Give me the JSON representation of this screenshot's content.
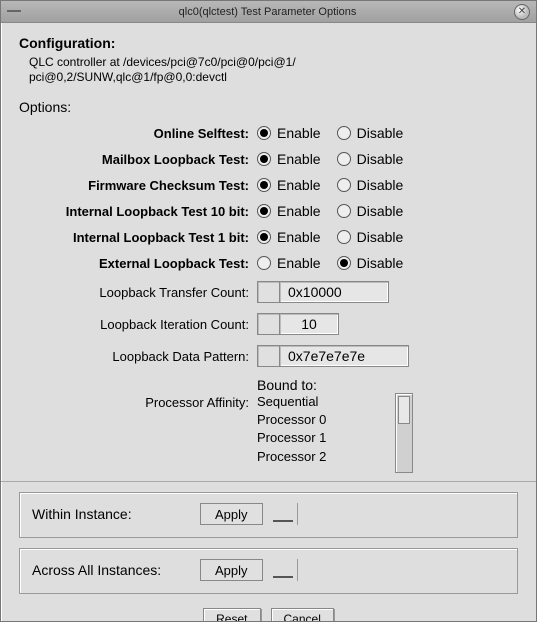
{
  "window": {
    "title": "qlc0(qlctest) Test Parameter Options"
  },
  "configuration": {
    "heading": "Configuration:",
    "body": "QLC controller at /devices/pci@7c0/pci@0/pci@1/\npci@0,2/SUNW,qlc@1/fp@0,0:devctl"
  },
  "options_heading": "Options:",
  "tests": [
    {
      "label": "Online Selftest:",
      "enable_label": "Enable",
      "disable_label": "Disable",
      "selected": "enable"
    },
    {
      "label": "Mailbox Loopback Test:",
      "enable_label": "Enable",
      "disable_label": "Disable",
      "selected": "enable"
    },
    {
      "label": "Firmware Checksum Test:",
      "enable_label": "Enable",
      "disable_label": "Disable",
      "selected": "enable"
    },
    {
      "label": "Internal Loopback Test 10 bit:",
      "enable_label": "Enable",
      "disable_label": "Disable",
      "selected": "enable"
    },
    {
      "label": "Internal Loopback Test  1 bit:",
      "enable_label": "Enable",
      "disable_label": "Disable",
      "selected": "enable"
    },
    {
      "label": "External Loopback Test:",
      "enable_label": "Enable",
      "disable_label": "Disable",
      "selected": "disable"
    }
  ],
  "fields": {
    "transfer_count": {
      "label": "Loopback Transfer Count:",
      "value": "0x10000"
    },
    "iteration_count": {
      "label": "Loopback Iteration Count:",
      "value": "10"
    },
    "data_pattern": {
      "label": "Loopback Data Pattern:",
      "value": "0x7e7e7e7e"
    }
  },
  "affinity": {
    "label": "Processor Affinity:",
    "bound_to": "Bound to:",
    "items": [
      "Sequential",
      "Processor 0",
      "Processor 1",
      "Processor 2"
    ]
  },
  "within_instance": {
    "label": "Within Instance:",
    "apply": "Apply"
  },
  "across_all": {
    "label": "Across All Instances:",
    "apply": "Apply"
  },
  "buttons": {
    "reset": "Reset",
    "cancel": "Cancel"
  }
}
